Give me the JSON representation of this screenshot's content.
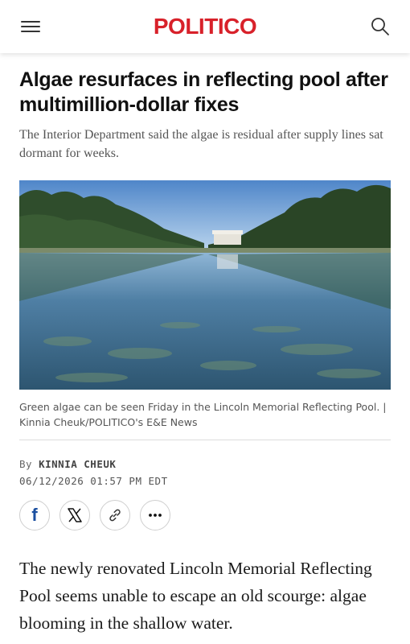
{
  "header": {
    "logo_text": "POLITICO",
    "logo_color": "#d8212a",
    "menu_icon": "hamburger-menu-icon",
    "search_icon": "search-icon"
  },
  "article": {
    "headline": "Algae resurfaces in reflecting pool after multimillion-dollar fixes",
    "dek": "The Interior Department said the algae is residual after supply lines sat dormant for weeks.",
    "photo_alt": "Lincoln Memorial Reflecting Pool with trees on both sides",
    "caption": "Green algae can be seen Friday in the Lincoln Memorial Reflecting Pool. | Kinnia Cheuk/POLITICO's E&E News",
    "byline_prefix": "By",
    "author": "KINNIA CHEUK",
    "date": "06/12/2026 01:57 PM EDT",
    "body_first": "The newly renovated Lincoln Memorial Reflecting Pool seems unable to escape an old scourge: algae blooming in the shallow water."
  },
  "share": {
    "facebook_label": "f",
    "icons": [
      "facebook-icon",
      "x-icon",
      "link-icon",
      "more-icon"
    ]
  }
}
